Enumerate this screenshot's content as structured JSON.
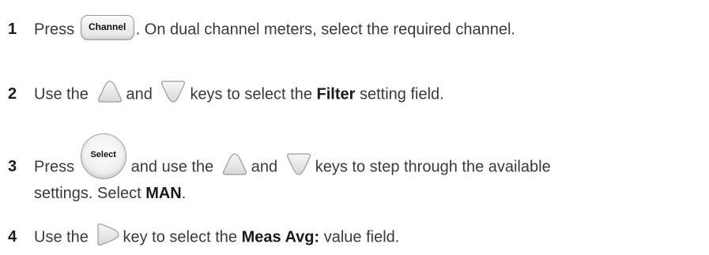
{
  "steps": [
    {
      "number": "1",
      "t1": "Press",
      "key": "Channel",
      "t2": ". On dual channel meters, select the required channel."
    },
    {
      "number": "2",
      "t1": "Use the",
      "t2": "and",
      "t3": "keys to select the",
      "bold": "Filter",
      "t4": "setting field."
    },
    {
      "number": "3",
      "t1": "Press",
      "key": "Select",
      "t2": "and use the",
      "t3": "and",
      "t4": "keys to step through the available",
      "t5": "settings. Select",
      "bold": "MAN",
      "t6": "."
    },
    {
      "number": "4",
      "t1": "Use the",
      "t2": "key to select the",
      "bold": "Meas Avg:",
      "t3": "value field."
    }
  ],
  "icons": [
    "channel-key-icon",
    "up-arrow-key-icon",
    "down-arrow-key-icon",
    "select-key-icon",
    "right-arrow-key-icon"
  ],
  "colors": {
    "text": "#3a3a3a",
    "key_fill": "#e4e4e4",
    "key_border": "#9a9a9a"
  }
}
